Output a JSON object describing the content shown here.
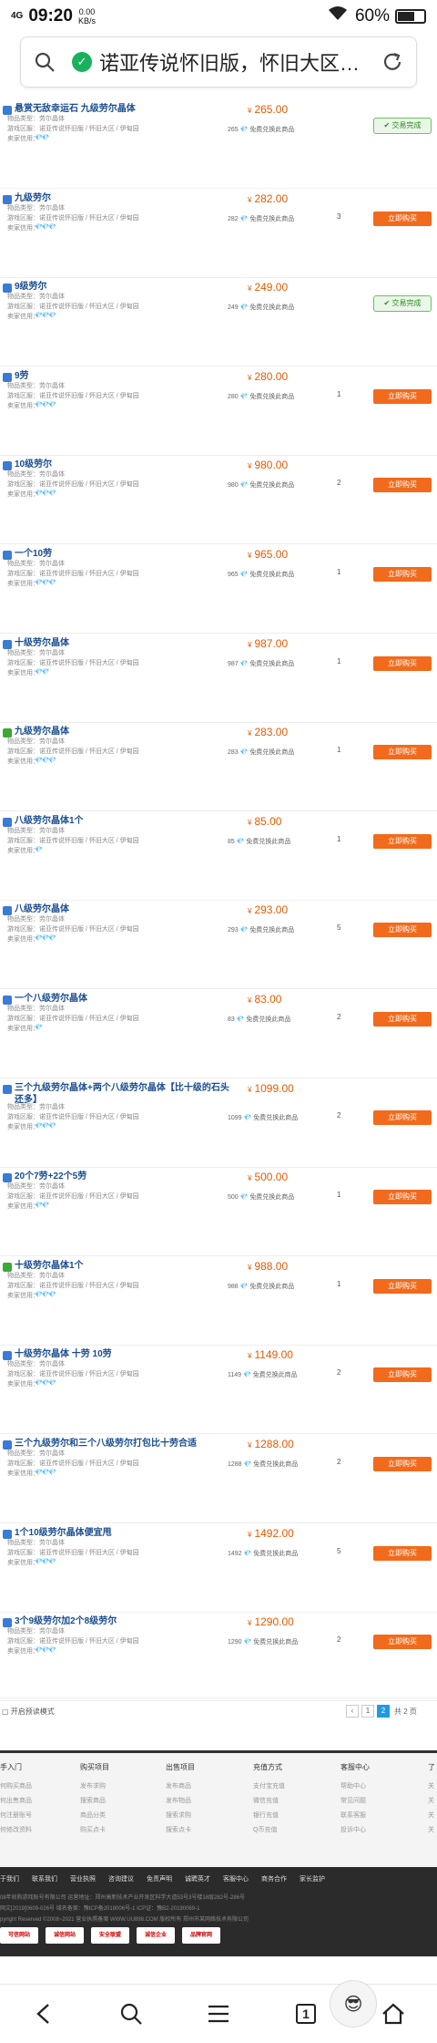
{
  "status_bar": {
    "signal": "4G",
    "time": "09:20",
    "net_speed_value": "0.00",
    "net_speed_unit": "KB/s",
    "battery": "60%",
    "battery_level": 0.6
  },
  "url_bar": {
    "text": "诺亚传说怀旧版，怀旧大区…",
    "search_icon": "search-icon",
    "secure_icon": "shield-check-icon",
    "reload_icon": "reload-icon"
  },
  "labels": {
    "meta_type": "物品类型：",
    "meta_region": "游戏区服：",
    "meta_seller": "卖家信用：",
    "stock_suffix": "免费兑换此商品",
    "yen": "¥",
    "buy": "立即购买",
    "done": "交易完成"
  },
  "colors": {
    "price": "#e65a00",
    "buy_button": "#f26a1b",
    "title": "#1a4d8f",
    "done": "#2a8a1f",
    "pager_active": "#1e9be6"
  },
  "listings": [
    {
      "title": "悬赏无敌幸运石 九级劳尔晶体",
      "type": "劳尔晶体",
      "region": "诺亚传说怀旧版 / 怀旧大区 / 伊甸园",
      "rating": "💎💎",
      "price": "265.00",
      "stock": "265",
      "qty": "",
      "status": "done",
      "badge": "blue"
    },
    {
      "title": "九级劳尔",
      "type": "劳尔晶体",
      "region": "诺亚传说怀旧版 / 怀旧大区 / 伊甸园",
      "rating": "💎💎💎",
      "price": "282.00",
      "stock": "282",
      "qty": "3",
      "status": "buy",
      "badge": "blue"
    },
    {
      "title": "9级劳尔",
      "type": "劳尔晶体",
      "region": "诺亚传说怀旧版 / 怀旧大区 / 伊甸园",
      "rating": "💎💎💎",
      "price": "249.00",
      "stock": "249",
      "qty": "",
      "status": "done",
      "badge": "blue"
    },
    {
      "title": "9劳",
      "type": "劳尔晶体",
      "region": "诺亚传说怀旧版 / 怀旧大区 / 伊甸园",
      "rating": "💎💎💎",
      "price": "280.00",
      "stock": "280",
      "qty": "1",
      "status": "buy",
      "badge": "blue"
    },
    {
      "title": "10级劳尔",
      "type": "劳尔晶体",
      "region": "诺亚传说怀旧版 / 怀旧大区 / 伊甸园",
      "rating": "💎💎💎",
      "price": "980.00",
      "stock": "980",
      "qty": "2",
      "status": "buy",
      "badge": "blue"
    },
    {
      "title": "一个10劳",
      "type": "劳尔晶体",
      "region": "诺亚传说怀旧版 / 怀旧大区 / 伊甸园",
      "rating": "💎💎💎",
      "price": "965.00",
      "stock": "965",
      "qty": "1",
      "status": "buy",
      "badge": "blue"
    },
    {
      "title": "十级劳尔晶体",
      "type": "劳尔晶体",
      "region": "诺亚传说怀旧版 / 怀旧大区 / 伊甸园",
      "rating": "💎💎",
      "price": "987.00",
      "stock": "987",
      "qty": "1",
      "status": "buy",
      "badge": "blue"
    },
    {
      "title": "九级劳尔晶体",
      "type": "劳尔晶体",
      "region": "诺亚传说怀旧版 / 怀旧大区 / 伊甸园",
      "rating": "💎💎💎",
      "price": "283.00",
      "stock": "283",
      "qty": "1",
      "status": "buy",
      "badge": "green"
    },
    {
      "title": "八级劳尔晶体1个",
      "type": "劳尔晶体",
      "region": "诺亚传说怀旧版 / 怀旧大区 / 伊甸园",
      "rating": "💎",
      "price": "85.00",
      "stock": "85",
      "qty": "1",
      "status": "buy",
      "badge": "blue"
    },
    {
      "title": "八级劳尔晶体",
      "type": "劳尔晶体",
      "region": "诺亚传说怀旧版 / 怀旧大区 / 伊甸园",
      "rating": "💎💎💎",
      "price": "293.00",
      "stock": "293",
      "qty": "5",
      "status": "buy",
      "badge": "blue"
    },
    {
      "title": "一个八级劳尔晶体",
      "type": "劳尔晶体",
      "region": "诺亚传说怀旧版 / 怀旧大区 / 伊甸园",
      "rating": "💎",
      "price": "83.00",
      "stock": "83",
      "qty": "2",
      "status": "buy",
      "badge": "blue"
    },
    {
      "title": "三个九级劳尔晶体+两个八级劳尔晶体【比十级的石头还多】",
      "type": "劳尔晶体",
      "region": "诺亚传说怀旧版 / 怀旧大区 / 伊甸园",
      "rating": "💎💎💎",
      "price": "1099.00",
      "stock": "1099",
      "qty": "2",
      "status": "buy",
      "badge": "blue"
    },
    {
      "title": "20个7劳+22个5劳",
      "type": "劳尔晶体",
      "region": "诺亚传说怀旧版 / 怀旧大区 / 伊甸园",
      "rating": "💎💎",
      "price": "500.00",
      "stock": "500",
      "qty": "1",
      "status": "buy",
      "badge": "blue"
    },
    {
      "title": "十级劳尔晶体1个",
      "type": "劳尔晶体",
      "region": "诺亚传说怀旧版 / 怀旧大区 / 伊甸园",
      "rating": "💎💎💎",
      "price": "988.00",
      "stock": "988",
      "qty": "1",
      "status": "buy",
      "badge": "green"
    },
    {
      "title": "十级劳尔晶体 十劳 10劳",
      "type": "劳尔晶体",
      "region": "诺亚传说怀旧版 / 怀旧大区 / 伊甸园",
      "rating": "💎💎💎",
      "price": "1149.00",
      "stock": "1149",
      "qty": "2",
      "status": "buy",
      "badge": "blue"
    },
    {
      "title": "三个九级劳尔和三个八级劳尔打包比十劳合适",
      "type": "劳尔晶体",
      "region": "诺亚传说怀旧版 / 怀旧大区 / 伊甸园",
      "rating": "💎💎💎",
      "price": "1288.00",
      "stock": "1288",
      "qty": "2",
      "status": "buy",
      "badge": "blue"
    },
    {
      "title": "1个10级劳尔晶体便宜甩",
      "type": "劳尔晶体",
      "region": "诺亚传说怀旧版 / 怀旧大区 / 伊甸园",
      "rating": "💎💎💎",
      "price": "1492.00",
      "stock": "1492",
      "qty": "5",
      "status": "buy",
      "badge": "blue"
    },
    {
      "title": "3个9级劳尔加2个8级劳尔",
      "type": "劳尔晶体",
      "region": "诺亚传说怀旧版 / 怀旧大区 / 伊甸园",
      "rating": "💎💎💎",
      "price": "1290.00",
      "stock": "1290",
      "qty": "2",
      "status": "buy",
      "badge": "blue"
    }
  ],
  "pager": {
    "mode_label": "开启预读模式",
    "prev": "‹",
    "pages": [
      "1",
      "2"
    ],
    "active_page": "2",
    "total": "共 2 页"
  },
  "footer": {
    "columns": [
      {
        "head": "手入门",
        "items": [
          "何购买商品",
          "何出售商品",
          "何注册账号",
          "何修改资料"
        ]
      },
      {
        "head": "购买项目",
        "items": [
          "发布求购",
          "搜索商品",
          "商品分类",
          "购买点卡"
        ]
      },
      {
        "head": "出售项目",
        "items": [
          "发布商品",
          "发布物品",
          "搜索求购",
          "搜索点卡"
        ]
      },
      {
        "head": "充值方式",
        "items": [
          "支付宝充值",
          "微信充值",
          "银行充值",
          "Q币充值"
        ]
      },
      {
        "head": "客服中心",
        "items": [
          "帮助中心",
          "常见问题",
          "联系客服",
          "投诉中心"
        ]
      },
      {
        "head": "了",
        "items": [
          "关",
          "关",
          "关",
          "关"
        ]
      }
    ],
    "nav": [
      "于我们",
      "联系我们",
      "营业执照",
      "咨询建议",
      "免责声明",
      "诚聘英才",
      "客服中心",
      "商务合作",
      "家长监护"
    ],
    "line1": "08年收购游戏账号有限公司 运营地址：郑州高新技术产业开发区科学大道53号3号楼18层282号-286号",
    "line2": "网文[2019]0609-026号   域名备案：豫ICP备2019006号-1   ICP证：豫B2-20190069-1",
    "line3": "pyright Reserved ©2008~2021 营业执照备案 WWW.UU898.COM 版权所有  郑州市某网络技术有限公司",
    "certs": [
      "可信网站",
      "诚信网站",
      "安全联盟",
      "诚信企业",
      "品牌官网"
    ]
  },
  "browser_bar": {
    "back_icon": "back-arrow-icon",
    "search_icon": "search-icon",
    "menu_icon": "menu-icon",
    "tabs_count": "1",
    "home_icon": "home-icon"
  }
}
